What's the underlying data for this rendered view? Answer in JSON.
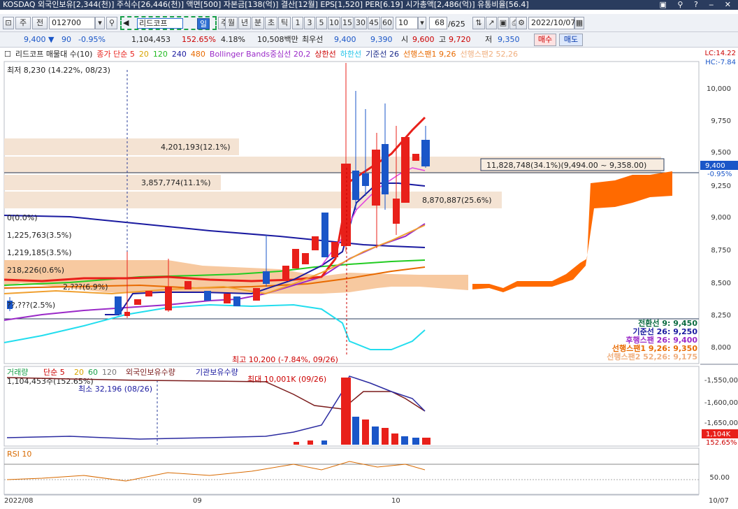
{
  "titlebar": {
    "text": "KOSDAQ 외국인보유[2,344(천)] 주식수[26,446(천)] 액면[500] 자본금[138(억)] 결산[12월] EPS[1,520] PER[6.19] 시가총액[2,486(억)] 유통비율[56.4]",
    "win_controls": "▣ ⚲ ? ‒ ✕"
  },
  "toolbar": {
    "main_label": "주",
    "prev_label": "전",
    "code": "012700",
    "stock_name": "리드코프",
    "periods": [
      "일",
      "주",
      "월",
      "년",
      "분",
      "초",
      "틱"
    ],
    "intervals": [
      "1",
      "3",
      "5",
      "10",
      "15",
      "30",
      "45",
      "60"
    ],
    "interval_select": "10",
    "count": "68",
    "total": "/625",
    "date": "2022/10/07"
  },
  "quote": {
    "price": "9,400 ▼",
    "change": "90",
    "change_pct": "-0.95%",
    "volume": "1,104,453",
    "volume_pct": "152.65%",
    "turnover": "4.18%",
    "amount": "10,508백만",
    "best_label": "최우선",
    "best_ask": "9,400",
    "best_bid": "9,390",
    "open_label": "시",
    "open": "9,600",
    "high_label": "고",
    "high": "9,720",
    "low_label": "저",
    "low": "9,350",
    "buy_label": "매수",
    "sell_label": "매도"
  },
  "legend": {
    "name": "리드코프 매물대 수(10)",
    "ma": "종가 단순 5",
    "ma20": "20",
    "ma120": "120",
    "ma240": "240",
    "ma480": "480",
    "bb": "Bollinger Bands중심선 20,2",
    "upper": "상한선",
    "lower": "하한선",
    "base": "기준선 26",
    "lead1": "선행스팬1 9,26",
    "lead2": "선행스팬2 52,26"
  },
  "price_axis": [
    "10,000",
    "9,750",
    "9,500",
    "9,250",
    "9,000",
    "8,750",
    "8,500",
    "8,250",
    "8,000"
  ],
  "lc_hc": {
    "lc": "LC:14.22",
    "hc": "HC:-7.84"
  },
  "current_tag": {
    "price": "9,400",
    "pct": "-0.95%"
  },
  "annotations": {
    "low_note": "최저 8,230 (14.22%, 08/23)",
    "high_note": "최고 10,200 (-7.84%, 09/26)",
    "vp1": "4,201,193(12.1%)",
    "vp2": "3,857,774(11.1%)",
    "vp3": "11,828,748(34.1%)(9,494.00 ~ 9,358.00)",
    "vp4": "8,870,887(25.6%)",
    "vp5": "0(0.0%)",
    "vp6": "1,225,763(3.5%)",
    "vp7": "1,219,185(3.5%)",
    "vp8": "218,226(0.6%)",
    "vp9": "2,???(6.9%)",
    "vp10": "??,???(2.5%)"
  },
  "ichimoku_box": {
    "line1": "전환선 9: 9,450",
    "line2": "기준선 26: 9,250",
    "line3": "후행스팬 26: 9,400",
    "line4": "선행스팬1 9,26: 9,350",
    "line5": "선행스팬2 52,26: 9,175"
  },
  "volume_panel": {
    "legend": [
      "거래량",
      "단순 5",
      "20",
      "60",
      "120",
      "외국인보유수량",
      "기관보유수량"
    ],
    "left_note": "1,104,453주(152.65%)",
    "min_note": "최소 32,196 (08/26)",
    "max_note": "최대 10,001K (09/26)",
    "axis": [
      "-1,550,00",
      "-1,600,00",
      "-1,650,00"
    ],
    "tag_vol": "1,104K",
    "tag_pct": "152.65%"
  },
  "rsi_panel": {
    "legend": "RSI 10",
    "axis": "50.00"
  },
  "dates": [
    "2022/08",
    "09",
    "10",
    "10/07"
  ],
  "colors": {
    "up": "#e8201a",
    "down": "#1a56c8",
    "cloud": "#f7c9a0",
    "lead1": "#ff6a00",
    "accent": "#2d6fd2"
  }
}
